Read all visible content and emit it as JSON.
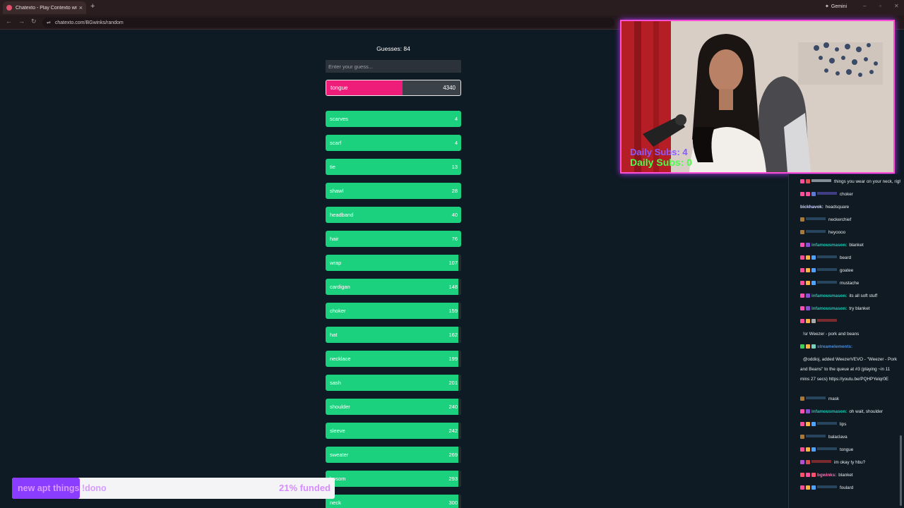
{
  "browser": {
    "tab_title": "Chatexto - Play Contexto with Y",
    "new_tab": "+",
    "close": "×",
    "gemini_label": "Gemini",
    "url": "chatexto.com/BGwinks/random"
  },
  "game": {
    "guesses_label": "Guesses: 84",
    "input_placeholder": "Enter your guess...",
    "current_guess": {
      "word": "tongue",
      "rank": "4340",
      "fill_fraction": 0.57
    },
    "rows": [
      {
        "word": "scarves",
        "rank": "4",
        "track_fraction": 0.0
      },
      {
        "word": "scarf",
        "rank": "4",
        "track_fraction": 0.0
      },
      {
        "word": "tie",
        "rank": "13",
        "track_fraction": 0.0
      },
      {
        "word": "shawl",
        "rank": "28",
        "track_fraction": 0.0
      },
      {
        "word": "headband",
        "rank": "40",
        "track_fraction": 0.0
      },
      {
        "word": "hair",
        "rank": "76",
        "track_fraction": 0.0
      },
      {
        "word": "wrap",
        "rank": "107",
        "track_fraction": 0.02
      },
      {
        "word": "cardigan",
        "rank": "148",
        "track_fraction": 0.02
      },
      {
        "word": "choker",
        "rank": "159",
        "track_fraction": 0.02
      },
      {
        "word": "hat",
        "rank": "162",
        "track_fraction": 0.02
      },
      {
        "word": "necklace",
        "rank": "199",
        "track_fraction": 0.02
      },
      {
        "word": "sash",
        "rank": "201",
        "track_fraction": 0.02
      },
      {
        "word": "shoulder",
        "rank": "240",
        "track_fraction": 0.02
      },
      {
        "word": "sleeve",
        "rank": "242",
        "track_fraction": 0.02
      },
      {
        "word": "sweater",
        "rank": "269",
        "track_fraction": 0.02
      },
      {
        "word": "bosom",
        "rank": "293",
        "track_fraction": 0.02
      },
      {
        "word": "neck",
        "rank": "300",
        "track_fraction": 0.02
      }
    ]
  },
  "overlay": {
    "daily_subs_a": "Daily Subs: 4",
    "daily_subs_b": "Daily Subs: 0",
    "goal_label": "new apt things !dono",
    "goal_percent": "21% funded",
    "goal_fraction": 0.21
  },
  "chat": {
    "messages": [
      {
        "name": "",
        "text": "things you wear on your neck, right?",
        "color": "#e8eef2",
        "badges": [
          "#ff4f9a",
          "#e14f4f"
        ]
      },
      {
        "name": "",
        "text": "choker",
        "color": "#6b5bd6",
        "badges": [
          "#ff4f9a",
          "#ff4f9a",
          "#5b7bd6"
        ]
      },
      {
        "name": "bickhavok:",
        "text": "headsquare",
        "color": "#cfd7ff",
        "badges": []
      },
      {
        "name": "",
        "text": "neckerchief",
        "color": "#3f6a90",
        "badges": [
          "#a8793a"
        ]
      },
      {
        "name": "",
        "text": "heyoooo",
        "color": "#3f6a90",
        "badges": [
          "#a8793a"
        ]
      },
      {
        "name": "infamousmason:",
        "text": "blanket",
        "color": "#18c7b4",
        "badges": [
          "#ff4fb5",
          "#8a4fd6"
        ]
      },
      {
        "name": "",
        "text": "beard",
        "color": "#3f6a90",
        "badges": [
          "#ff4f9a",
          "#ffb23f",
          "#4fa3ff"
        ]
      },
      {
        "name": "",
        "text": "goatee",
        "color": "#3f6a90",
        "badges": [
          "#ff4f9a",
          "#ffb23f",
          "#4fa3ff"
        ]
      },
      {
        "name": "",
        "text": "mustache",
        "color": "#3f6a90",
        "badges": [
          "#ff4f9a",
          "#ffb23f",
          "#4fa3ff"
        ]
      },
      {
        "name": "infamousmason:",
        "text": "its all soft stuff",
        "color": "#18c7b4",
        "badges": [
          "#ff4fb5",
          "#8a4fd6"
        ]
      },
      {
        "name": "infamousmason:",
        "text": "try blanket",
        "color": "#18c7b4",
        "badges": [
          "#ff4fb5",
          "#8a4fd6"
        ]
      },
      {
        "name": "",
        "text": "",
        "color": "#d43a3a",
        "badges": [
          "#ff4f9a",
          "#ffb23f",
          "#aaaaaa"
        ]
      },
      {
        "name": "",
        "text": "!sr Weezer - pork and beans",
        "color": "#e8eef2",
        "badges": []
      },
      {
        "name": "streamelements:",
        "text": "",
        "color": "#4f8bd6",
        "badges": [
          "#3fcf5a",
          "#ffb23f",
          "#7ad0c0"
        ]
      },
      {
        "name": "",
        "text": "@oddioj, added WeezerVEVO - \"Weezer - Pork and Beans\" to the queue at #3 (playing ~in 11 mins 27 secs) https://youtu.be/PQHPYelqr0E",
        "color": "#e8eef2",
        "badges": []
      },
      {
        "name": "",
        "text": "mask",
        "color": "#3f6a90",
        "badges": [
          "#a8793a"
        ]
      },
      {
        "name": "infamousmason:",
        "text": "oh wait, shoulder",
        "color": "#18c7b4",
        "badges": [
          "#ff4fb5",
          "#8a4fd6"
        ]
      },
      {
        "name": "",
        "text": "lips",
        "color": "#3f6a90",
        "badges": [
          "#ff4f9a",
          "#ffb23f",
          "#4fa3ff"
        ]
      },
      {
        "name": "",
        "text": "balaclava",
        "color": "#3f6a90",
        "badges": [
          "#a8793a"
        ]
      },
      {
        "name": "",
        "text": "tongue",
        "color": "#3f6a90",
        "badges": [
          "#ff4f9a",
          "#ffb23f",
          "#4fa3ff"
        ]
      },
      {
        "name": "",
        "text": "im okay ty hbu?",
        "color": "#d43a3a",
        "badges": [
          "#b44fd6",
          "#d64f4f"
        ]
      },
      {
        "name": "bgwinks:",
        "text": "blanket",
        "color": "#ff6fb5",
        "badges": [
          "#ff4f6a",
          "#ff4f9a",
          "#ff4f6a"
        ]
      },
      {
        "name": "",
        "text": "foulard",
        "color": "#3f6a90",
        "badges": [
          "#ff4f9a",
          "#ffb23f",
          "#4fa3ff"
        ]
      }
    ]
  }
}
